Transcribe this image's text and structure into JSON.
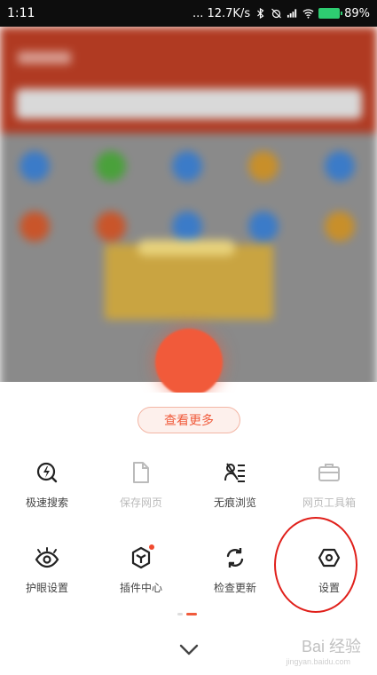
{
  "status_bar": {
    "time": "1:11",
    "network_speed": "... 12.7K/s",
    "battery_percent": "89%"
  },
  "sheet": {
    "more_label": "查看更多",
    "rows": [
      [
        {
          "label": "极速搜索",
          "icon": "lightning-search-icon",
          "enabled": true
        },
        {
          "label": "保存网页",
          "icon": "document-icon",
          "enabled": false
        },
        {
          "label": "无痕浏览",
          "icon": "incognito-icon",
          "enabled": true
        },
        {
          "label": "网页工具箱",
          "icon": "toolbox-icon",
          "enabled": false
        }
      ],
      [
        {
          "label": "护眼设置",
          "icon": "eye-icon",
          "enabled": true
        },
        {
          "label": "插件中心",
          "icon": "cube-icon",
          "enabled": true,
          "badge": true
        },
        {
          "label": "检查更新",
          "icon": "refresh-icon",
          "enabled": true
        },
        {
          "label": "设置",
          "icon": "settings-icon",
          "enabled": true
        }
      ]
    ]
  },
  "watermark": {
    "text": "Bai 经验",
    "sub": "jingyan.baidu.com"
  },
  "colors": {
    "accent": "#f05b3c",
    "annotation": "#e0201b",
    "header_bg": "#b03a22"
  }
}
